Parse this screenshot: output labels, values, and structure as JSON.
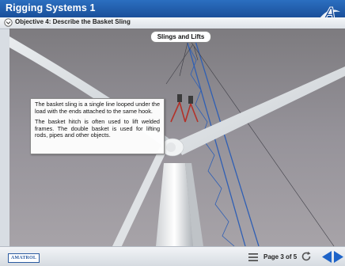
{
  "header": {
    "title": "Rigging Systems 1",
    "logo_icon": "amatrol-a-logo-icon"
  },
  "objective": {
    "icon": "chevron-down-circle-icon",
    "text": "Objective 4: Describe the Basket Sling"
  },
  "slide": {
    "title": "Slings and Lifts",
    "paragraphs": [
      "The basket sling is a single line looped under the load with the ends attached to the same hook.",
      "The basket hitch is often used to lift welded frames. The double basket is used for lifting rods, pipes and other objects."
    ],
    "image_description_icon": "wind-turbine-crane-photo"
  },
  "footer": {
    "brand": "AMATROL",
    "menu_icon": "menu-icon",
    "page_indicator": "Page 3 of 5",
    "refresh_icon": "refresh-icon",
    "prev_icon": "previous-arrow-icon",
    "next_icon": "next-arrow-icon"
  },
  "colors": {
    "header_blue": "#1f5aa8",
    "nav_blue": "#1e63c8"
  }
}
